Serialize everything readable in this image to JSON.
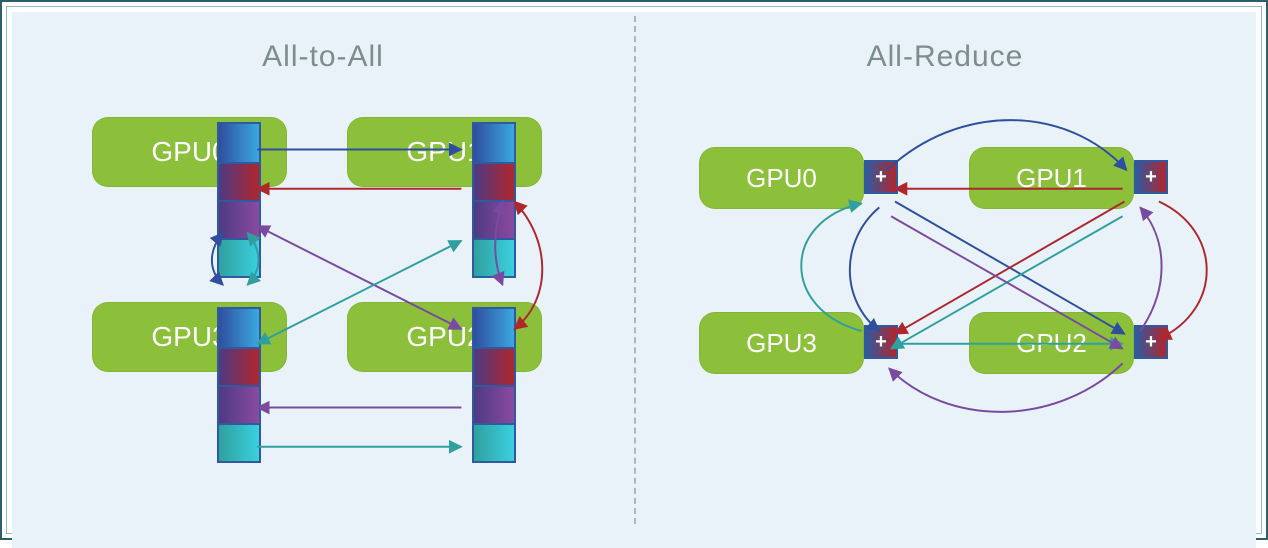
{
  "left": {
    "title": "All-to-All",
    "gpus": [
      "GPU0",
      "GPU1",
      "GPU2",
      "GPU3"
    ],
    "colors": {
      "c0": "linear-gradient(90deg,#2f4f9e,#3aa8e0)",
      "c1": "linear-gradient(90deg,#4e3a84,#b0262e)",
      "c2": "linear-gradient(90deg,#4e3a84,#8a4aa0)",
      "c3": "linear-gradient(90deg,#2fa09e,#3ad0e0)"
    }
  },
  "right": {
    "title": "All-Reduce",
    "gpus": [
      "GPU0",
      "GPU1",
      "GPU2",
      "GPU3"
    ],
    "op": "+"
  }
}
